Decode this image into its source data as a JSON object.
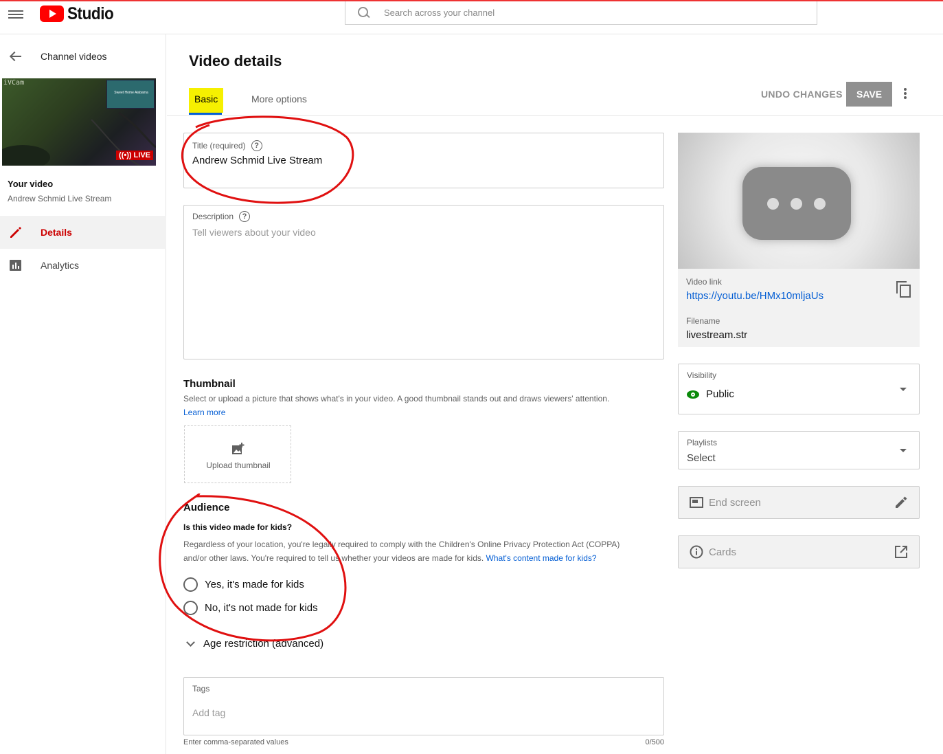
{
  "header": {
    "logo_text": "Studio",
    "search_placeholder": "Search across your channel"
  },
  "sidebar": {
    "back_label": "Channel videos",
    "thumbnail": {
      "watermark": "iVCam",
      "inset_text": "Sweet Home Alabama",
      "live_badge": "LIVE"
    },
    "your_video_label": "Your video",
    "video_title": "Andrew Schmid Live Stream",
    "nav": [
      {
        "label": "Details",
        "icon": "pencil-icon",
        "active": true
      },
      {
        "label": "Analytics",
        "icon": "bar-chart-icon",
        "active": false
      }
    ]
  },
  "main": {
    "title": "Video details",
    "tabs": [
      {
        "label": "Basic",
        "active": true
      },
      {
        "label": "More options",
        "active": false
      }
    ],
    "undo_label": "UNDO CHANGES",
    "save_label": "SAVE",
    "title_field": {
      "label": "Title (required)",
      "value": "Andrew Schmid Live Stream"
    },
    "description_field": {
      "label": "Description",
      "placeholder": "Tell viewers about your video"
    },
    "thumbnail": {
      "title": "Thumbnail",
      "desc": "Select or upload a picture that shows what's in your video. A good thumbnail stands out and draws viewers' attention.",
      "learn_more": "Learn more",
      "upload_label": "Upload thumbnail"
    },
    "audience": {
      "title": "Audience",
      "question": "Is this video made for kids?",
      "desc_line1": "Regardless of your location, you're legally required to comply with the Children's Online Privacy Protection Act (COPPA)",
      "desc_line2": "and/or other laws. You're required to tell us whether your videos are made for kids. ",
      "desc_link": "What's content made for kids?",
      "options": [
        "Yes, it's made for kids",
        "No, it's not made for kids"
      ]
    },
    "age_restriction_label": "Age restriction (advanced)",
    "tags": {
      "label": "Tags",
      "placeholder": "Add tag",
      "help": "Enter comma-separated values",
      "count": "0/500"
    }
  },
  "right_panel": {
    "video_link_label": "Video link",
    "video_link": "https://youtu.be/HMx10mljaUs",
    "filename_label": "Filename",
    "filename": "livestream.str",
    "visibility_label": "Visibility",
    "visibility_value": "Public",
    "playlists_label": "Playlists",
    "playlists_value": "Select",
    "end_screen_label": "End screen",
    "cards_label": "Cards"
  },
  "colors": {
    "brand_red": "#ff0000",
    "active_red": "#cc0000",
    "link_blue": "#065fd4",
    "highlight_yellow": "#f6f000",
    "annotation_red": "#e01010",
    "public_green": "#0a8a0a"
  }
}
